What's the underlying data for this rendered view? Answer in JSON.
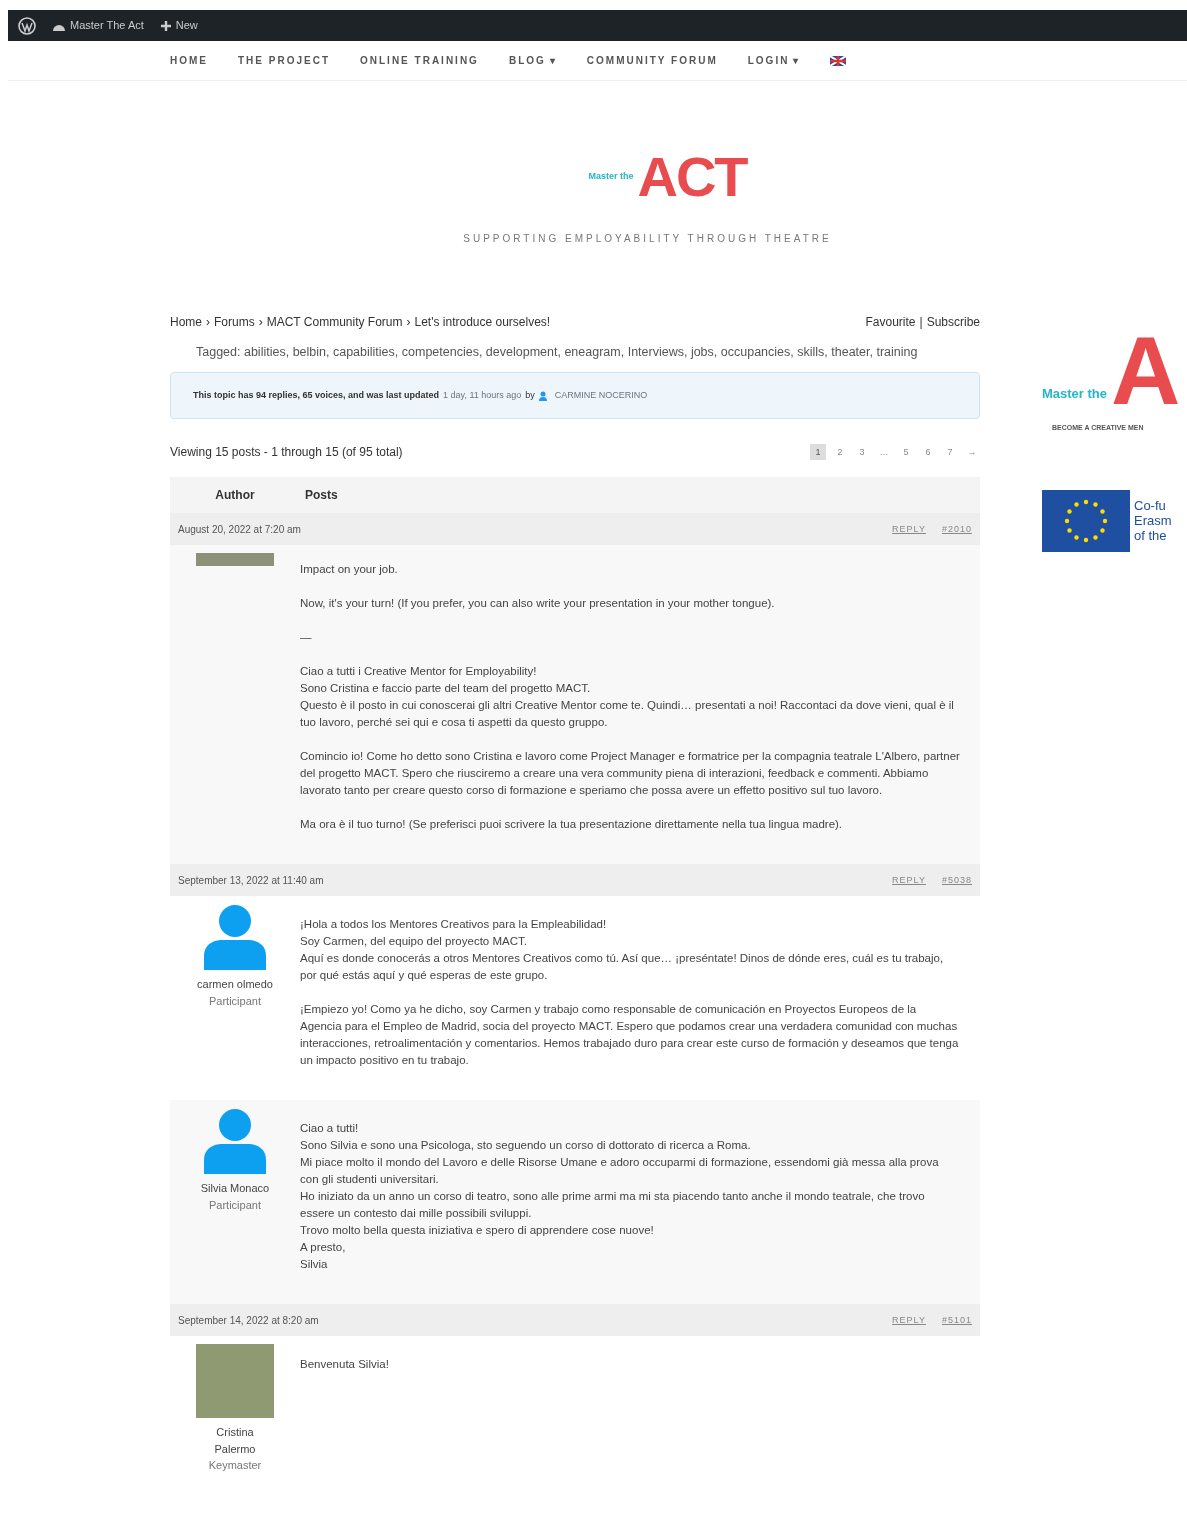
{
  "admin_bar": {
    "site": "Master The Act",
    "new": "New"
  },
  "nav": [
    {
      "label": "HOME"
    },
    {
      "label": "THE PROJECT"
    },
    {
      "label": "ONLINE TRAINING"
    },
    {
      "label": "BLOG",
      "caret": "▾"
    },
    {
      "label": "COMMUNITY FORUM"
    },
    {
      "label": "LOGIN",
      "caret": "▾"
    }
  ],
  "header": {
    "logo_small": "Master the",
    "logo_big": "ACT",
    "tagline": "SUPPORTING EMPLOYABILITY THROUGH THEATRE"
  },
  "breadcrumb": [
    "Home",
    "Forums",
    "MACT Community Forum",
    "Let's introduce ourselves!"
  ],
  "breadcrumb_separator": "›",
  "topic_actions": [
    "Favourite",
    "Subscribe"
  ],
  "action_separator": "|",
  "tags_label": "Tagged:",
  "tags": [
    "abilities,",
    "belbin,",
    "capabilities,",
    "competencies,",
    "development,",
    "eneagram,",
    "Interviews,",
    "jobs,",
    "occupancies,",
    "skills,",
    "theater,",
    "training"
  ],
  "notice": {
    "text": "This topic has 94 replies, 65 voices, and was last updated",
    "time": "1 day, 11 hours ago",
    "by": "by",
    "user": "CARMINE NOCERINO"
  },
  "viewing": "Viewing 15 posts - 1 through 15 (of 95 total)",
  "pagination": [
    {
      "label": "1",
      "selected": true
    },
    {
      "label": "2",
      "selected": false
    },
    {
      "label": "3",
      "selected": false
    },
    {
      "label": "…",
      "selected": false
    },
    {
      "label": "5",
      "selected": false
    },
    {
      "label": "6",
      "selected": false
    },
    {
      "label": "7",
      "selected": false
    },
    {
      "label": "→",
      "selected": false
    }
  ],
  "columns": [
    "Author",
    "Posts"
  ],
  "posts": [
    {
      "date": "August 20, 2022 at 7:20 am",
      "reply": "REPLY",
      "id": "#2010",
      "kind": "photo-strip",
      "paragraphs": [
        [
          "Impact on your job."
        ],
        [
          "Now, it's your turn! (If you prefer, you can also write your presentation in your mother tongue)."
        ],
        [
          "—"
        ],
        [
          "Ciao a tutti i Creative Mentor for Employability!",
          "Sono Cristina e faccio parte del team del progetto MACT.",
          "Questo è il posto in cui conoscerai gli altri Creative Mentor come te. Quindi… presentati a noi! Raccontaci da dove vieni, qual è il tuo lavoro, perché sei qui e cosa ti aspetti da questo gruppo."
        ],
        [
          "Comincio io! Come ho detto sono Cristina e lavoro come Project Manager e formatrice per la compagnia teatrale L'Albero, partner del progetto MACT. Spero che riusciremo a creare una vera community piena di interazioni, feedback e commenti. Abbiamo lavorato tanto per creare questo corso di formazione e speriamo che possa avere un effetto positivo sul tuo lavoro."
        ],
        [
          "Ma ora è il tuo turno! (Se preferisci puoi scrivere la tua presentazione direttamente nella tua lingua madre)."
        ]
      ]
    },
    {
      "date": "September 13, 2022 at 11:40 am",
      "reply": "REPLY",
      "id": "#5038",
      "kind": "silhouette",
      "author": [
        "carmen olmedo",
        "Participant"
      ],
      "paragraphs": [
        [
          "¡Hola a todos los Mentores Creativos para la Empleabilidad!",
          "Soy Carmen, del equipo del proyecto MACT.",
          "Aquí es donde conocerás a otros Mentores Creativos como tú. Así que… ¡preséntate! Dinos de dónde eres, cuál es tu trabajo, por qué estás aquí y qué esperas de este grupo."
        ],
        [
          "¡Empiezo yo! Como ya he dicho, soy Carmen y trabajo como responsable de comunicación en Proyectos Europeos de la Agencia para el Empleo de Madrid, socia del proyecto MACT. Espero que podamos crear una verdadera comunidad con muchas interacciones, retroalimentación y comentarios. Hemos trabajado duro para crear este curso de formación y deseamos que tenga un impacto positivo en tu trabajo."
        ]
      ]
    },
    {
      "kind": "silhouette",
      "author": [
        "Silvia Monaco",
        "Participant"
      ],
      "paragraphs": [
        [
          "Ciao a tutti!",
          "Sono Silvia e sono una Psicologa, sto seguendo un corso di dottorato di ricerca a Roma.",
          "Mi piace molto il mondo del Lavoro e delle Risorse Umane e adoro occuparmi di formazione, essendomi già messa alla prova con gli studenti universitari.",
          "Ho iniziato da un anno un corso di teatro, sono alle prime armi ma mi sta piacendo tanto anche il mondo teatrale, che trovo essere un contesto dai mille possibili sviluppi.",
          "Trovo molto bella questa iniziativa e spero di apprendere cose nuove!",
          "A presto,",
          "Silvia"
        ]
      ]
    },
    {
      "date": "September 14, 2022 at 8:20 am",
      "reply": "REPLY",
      "id": "#5101",
      "kind": "photo",
      "author": [
        "Cristina Palermo",
        "Keymaster"
      ],
      "paragraphs": [
        [
          "Benvenuta Silvia!"
        ]
      ]
    }
  ],
  "sidebar": {
    "logo_small": "Master the",
    "logo_big": "A",
    "logo_tagline": "BECOME A CREATIVE MEN",
    "eu_lines": [
      "Co-fu",
      "Erasm",
      "of the"
    ]
  }
}
